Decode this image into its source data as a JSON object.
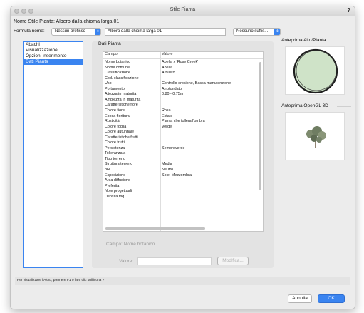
{
  "window": {
    "title": "Stile Pianta",
    "help": "?"
  },
  "header": {
    "style_name": "Nome Stile Pianta: Albero dalla chioma larga 01",
    "formula_label": "Formula nome:",
    "prefix_value": "Nessun prefisso",
    "name_value": "Albero dalla chioma larga 01",
    "suffix_value": "Nessuno suffis..."
  },
  "sidebar": {
    "items": [
      {
        "label": "Abachi",
        "selected": false
      },
      {
        "label": "Visualizzazione",
        "selected": false
      },
      {
        "label": "Opzioni inserimento",
        "selected": false
      },
      {
        "label": "Dati Pianta",
        "selected": true
      }
    ]
  },
  "panel": {
    "title": "Dati Pianta",
    "col_field": "Campo",
    "col_value": "Valore",
    "rows": [
      {
        "field": "Nome botanico",
        "value": "Abelia x 'Rose Creek'"
      },
      {
        "field": "Nome comune",
        "value": "Abelia"
      },
      {
        "field": "Classificazione",
        "value": "Arbusto"
      },
      {
        "field": "Cod. classificazione",
        "value": ""
      },
      {
        "field": "Uso",
        "value": "Controllo erosione, Bassa manutenzione"
      },
      {
        "field": "Portamento",
        "value": "Arrotondato"
      },
      {
        "field": "Altezza in maturità",
        "value": "0.80 - 0.75m"
      },
      {
        "field": "Ampiezza in maturità",
        "value": ""
      },
      {
        "field": "Caratteristiche fiore",
        "value": ""
      },
      {
        "field": "Colore fiore",
        "value": "Rosa"
      },
      {
        "field": "Epoca fioritura",
        "value": "Estate"
      },
      {
        "field": "Rusticità",
        "value": "Pianta che tollera l'ombra"
      },
      {
        "field": "Colore foglia",
        "value": "Verde"
      },
      {
        "field": "Colore autunnale",
        "value": ""
      },
      {
        "field": "Caratteristiche frutti",
        "value": ""
      },
      {
        "field": "Colore frutti",
        "value": ""
      },
      {
        "field": "Persistenza",
        "value": "Sempreverde"
      },
      {
        "field": "Tolleranza a",
        "value": ""
      },
      {
        "field": "Tipo terreno",
        "value": ""
      },
      {
        "field": "Struttura terreno",
        "value": "Media"
      },
      {
        "field": "pH",
        "value": "Neutro"
      },
      {
        "field": "Esposizione",
        "value": "Sole, Mezzombra"
      },
      {
        "field": "Area diffusione",
        "value": ""
      },
      {
        "field": "Preferita",
        "value": ""
      },
      {
        "field": "Note progettuali",
        "value": ""
      },
      {
        "field": "Densità mq",
        "value": ""
      }
    ],
    "campo_label": "Campo:  Nome botanico",
    "valore_label": "Valore:",
    "valore_value": "",
    "modify_button": "Modifica..."
  },
  "previews": {
    "top_title": "Anteprima Alto/Pianta",
    "opengl_title": "Anteprima OpenGL 3D"
  },
  "status": "Per visualizzare l'Aiuto, premere F1 o fare clic sull'icona ?",
  "footer": {
    "cancel": "Annulla",
    "ok": "OK"
  },
  "colors": {
    "accent": "#3a84f0",
    "canopy": "#cfe3c8",
    "outline": "#1f1f1f"
  }
}
